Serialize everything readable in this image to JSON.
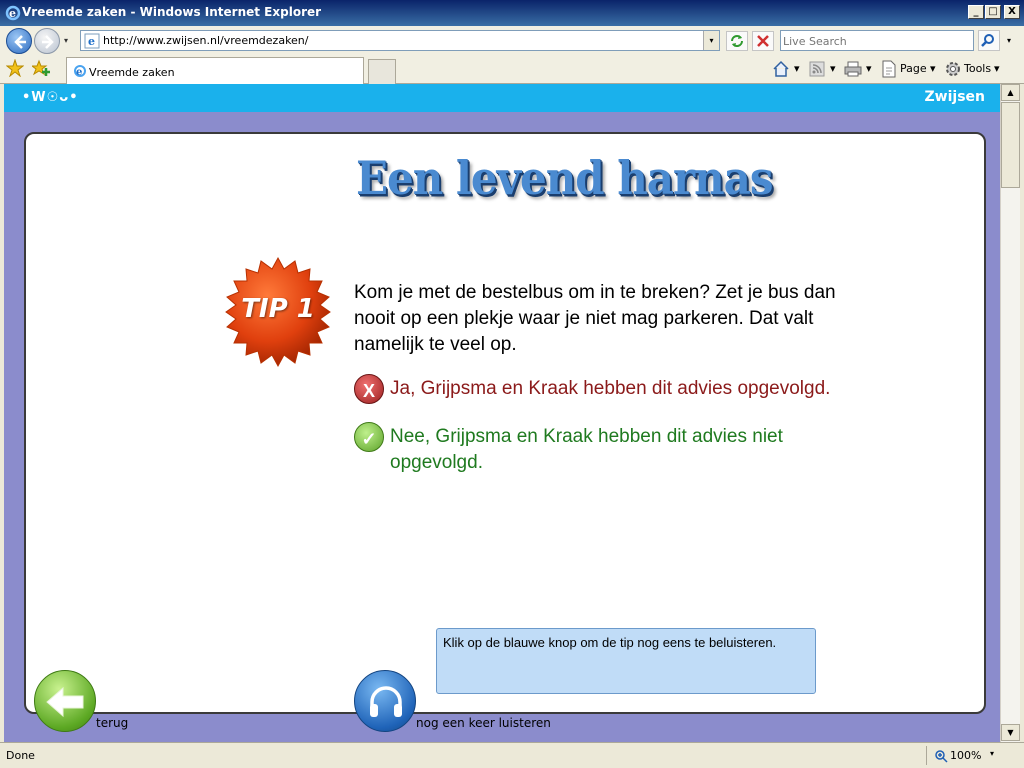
{
  "window": {
    "title": "Vreemde zaken - Windows Internet Explorer",
    "min": "_",
    "max": "□",
    "close": "X"
  },
  "toolbar": {
    "url": "http://www.zwijsen.nl/vreemdezaken/",
    "search_placeholder": "Live Search",
    "page_label": "Page",
    "tools_label": "Tools",
    "dropdown": "▾"
  },
  "tabs": [
    {
      "label": "Vreemde zaken",
      "active": true
    }
  ],
  "page": {
    "logo": "•W☉ᴗ•",
    "brand": "Zwijsen",
    "heading": "Een levend harnas",
    "tip_badge": "TIP 1",
    "tip_text": "Kom je met de bestelbus om in te breken? Zet je bus dan nooit op een plekje waar je niet mag parkeren. Dat valt namelijk te veel op.",
    "answers": [
      {
        "mark": "X",
        "text": "Ja, Grijpsma en Kraak hebben dit advies opgevolgd.",
        "correct": false
      },
      {
        "mark": "✓",
        "text": "Nee, Grijpsma en Kraak hebben dit advies niet opgevolgd.",
        "correct": true
      }
    ],
    "hint": "Klik op de blauwe knop om de tip nog eens te beluisteren.",
    "back_label": "terug",
    "listen_label": "nog een keer luisteren",
    "colors": {
      "header": "#1ab1ec",
      "background": "#8b8ccc",
      "heading": "#4a8ad0",
      "wrong": "#8b1a1a",
      "right": "#1f7a1f",
      "hint_bg": "#c0dcf7"
    }
  },
  "status": {
    "text": "Done",
    "zoom": "100%"
  }
}
